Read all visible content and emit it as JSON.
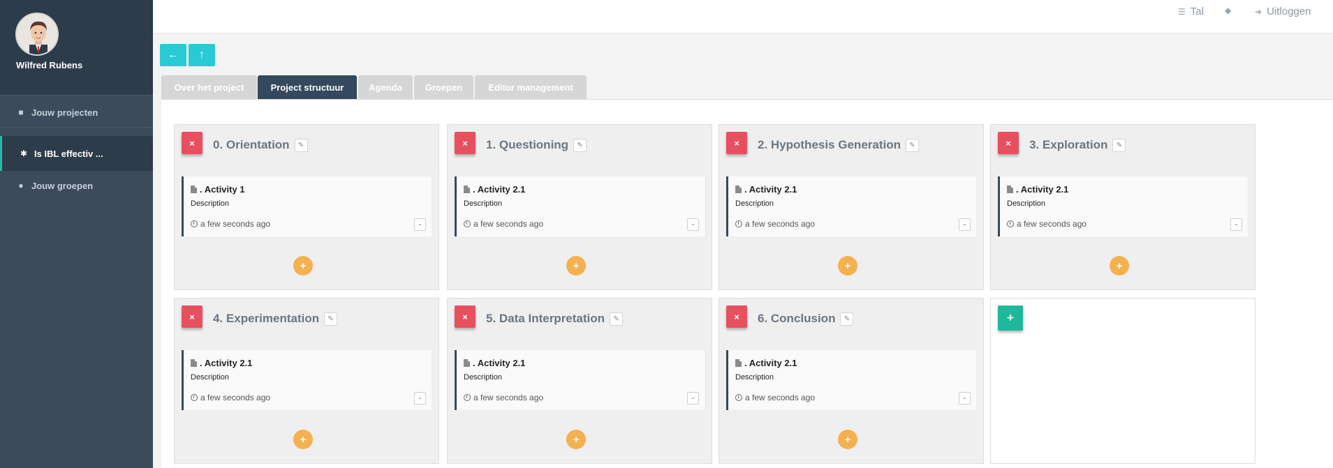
{
  "sidebar": {
    "user_name": "Wilfred Rubens",
    "items": [
      {
        "label": "Jouw projecten",
        "icon": "folder-icon"
      },
      {
        "label": "Is IBL effectiv ...",
        "icon": "asterisk-icon"
      },
      {
        "label": "Jouw groepen",
        "icon": "users-icon"
      }
    ]
  },
  "topbar": {
    "language_label": "Tal",
    "logout_label": "Uitloggen"
  },
  "nav_buttons": {
    "back_icon": "arrow-left-icon",
    "up_icon": "arrow-up-icon"
  },
  "tabs": [
    {
      "label": "Over het project",
      "active": false
    },
    {
      "label": "Project structuur",
      "active": true
    },
    {
      "label": "Agenda",
      "active": false
    },
    {
      "label": "Groepen",
      "active": false
    },
    {
      "label": "Editor management",
      "active": false
    }
  ],
  "phases": [
    {
      "title": "0. Orientation",
      "activity": {
        "title": ". Activity 1",
        "description": "Description",
        "time": "a few seconds ago"
      }
    },
    {
      "title": "1. Questioning",
      "activity": {
        "title": ". Activity 2.1",
        "description": "Description",
        "time": "a few seconds ago"
      }
    },
    {
      "title": "2. Hypothesis Generation",
      "activity": {
        "title": ". Activity 2.1",
        "description": "Description",
        "time": "a few seconds ago"
      }
    },
    {
      "title": "3. Exploration",
      "activity": {
        "title": ". Activity 2.1",
        "description": "Description",
        "time": "a few seconds ago"
      }
    },
    {
      "title": "4. Experimentation",
      "activity": {
        "title": ". Activity 2.1",
        "description": "Description",
        "time": "a few seconds ago"
      }
    },
    {
      "title": "5. Data Interpretation",
      "activity": {
        "title": ". Activity 2.1",
        "description": "Description",
        "time": "a few seconds ago"
      }
    },
    {
      "title": "6. Conclusion",
      "activity": {
        "title": ". Activity 2.1",
        "description": "Description",
        "time": "a few seconds ago"
      }
    }
  ],
  "symbols": {
    "delete": "×",
    "add": "+",
    "minus": "-"
  },
  "colors": {
    "sidebar": "#3b4b5b",
    "accent_cyan": "#29cad4",
    "delete_red": "#e8505f",
    "add_orange": "#f5b150",
    "add_green": "#1fb89a",
    "active_tab": "#34495e"
  }
}
